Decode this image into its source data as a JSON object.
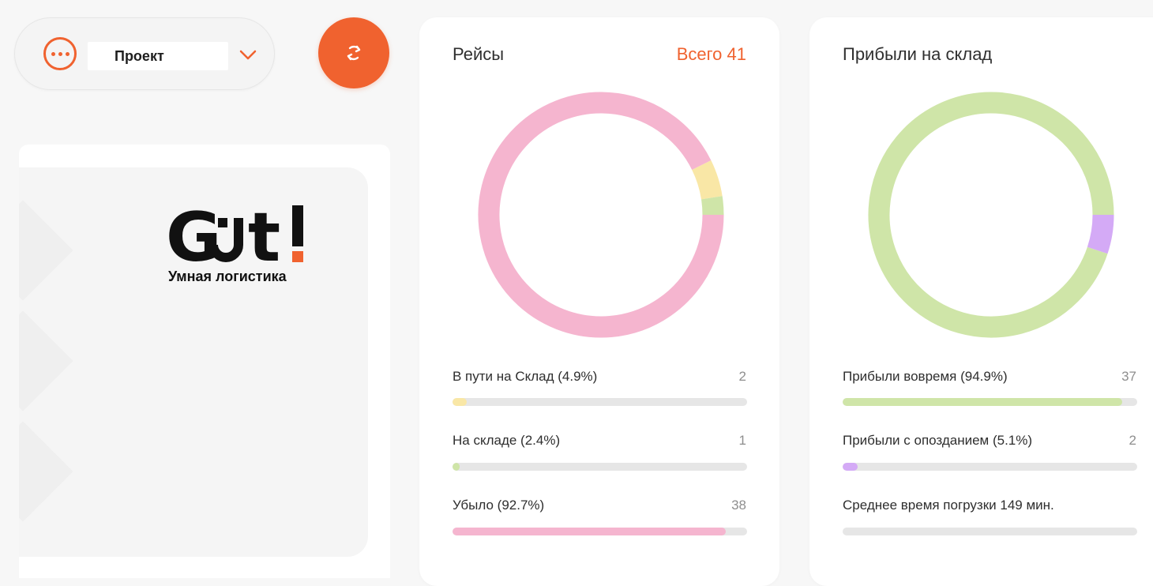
{
  "header": {
    "project_label": "Проект",
    "menu_icon": "more-dots-icon",
    "dropdown_icon": "chevron-down-icon",
    "refresh_icon": "refresh-icon"
  },
  "logo": {
    "wordmark": "Gut!",
    "tagline": "Умная логистика"
  },
  "colors": {
    "accent": "#f0622f",
    "pink": "#f5b5cf",
    "yellow": "#f9e7a6",
    "green": "#cfe5a8",
    "purple": "#d4aaf6",
    "gray": "#dcdcdc",
    "track": "#e6e6e6"
  },
  "trips": {
    "title": "Рейсы",
    "total": "Всего 41",
    "stats": [
      {
        "label": "В пути на Склад (4.9%)",
        "count": "2",
        "percent": 4.9,
        "color": "#f9e7a6"
      },
      {
        "label": "На складе (2.4%)",
        "count": "1",
        "percent": 2.4,
        "color": "#cfe5a8"
      },
      {
        "label": "Убыло (92.7%)",
        "count": "38",
        "percent": 92.7,
        "color": "#f5b5cf"
      }
    ]
  },
  "warehouse": {
    "title": "Прибыли на склад",
    "stats": [
      {
        "label": "Прибыли вовремя (94.9%)",
        "count": "37",
        "percent": 94.9,
        "color": "#cfe5a8"
      },
      {
        "label": "Прибыли с опозданием (5.1%)",
        "count": "2",
        "percent": 5.1,
        "color": "#d4aaf6"
      },
      {
        "label": "Среднее время погрузки 149 мин.",
        "count": "",
        "percent": 0,
        "color": "#e6e6e6"
      }
    ]
  },
  "chart_data": [
    {
      "type": "pie",
      "categories": [
        "В пути на Склад",
        "На складе",
        "Убыло"
      ],
      "values": [
        2,
        1,
        38
      ],
      "colors": [
        "#f9e7a6",
        "#cfe5a8",
        "#f5b5cf"
      ]
    },
    {
      "type": "pie",
      "categories": [
        "Прибыли вовремя",
        "Прибыли с опозданием"
      ],
      "values": [
        37,
        2
      ],
      "colors": [
        "#cfe5a8",
        "#d4aaf6"
      ]
    }
  ]
}
